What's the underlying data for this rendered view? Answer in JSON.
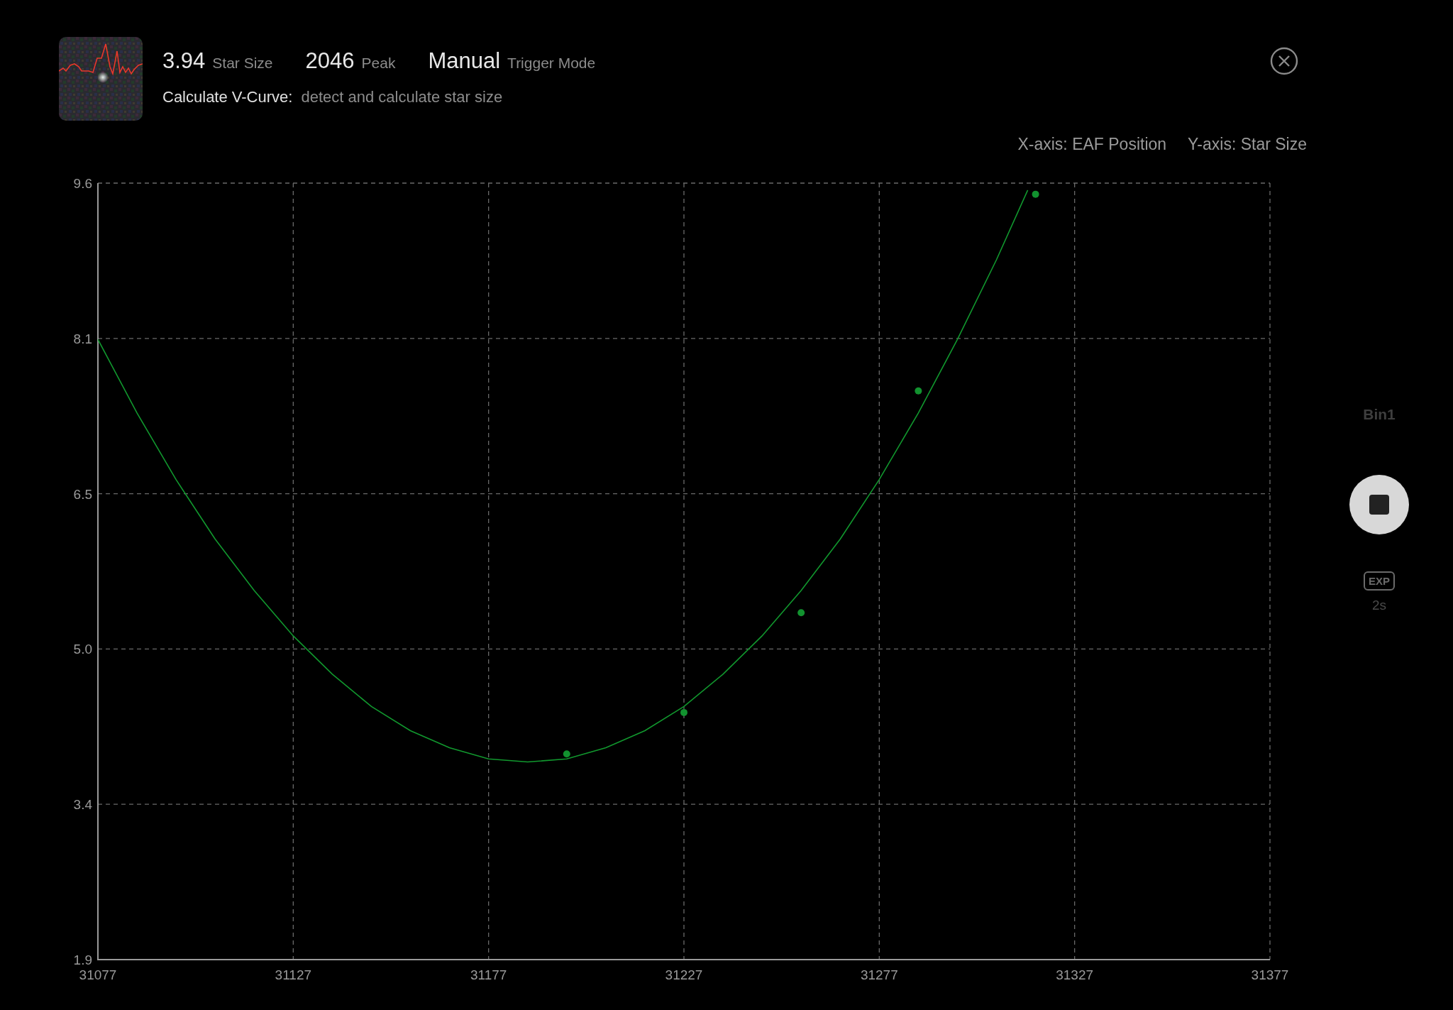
{
  "header": {
    "stats": [
      {
        "value": "3.94",
        "label": "Star Size"
      },
      {
        "value": "2046",
        "label": "Peak"
      },
      {
        "value": "Manual",
        "label": "Trigger Mode"
      }
    ],
    "task_title": "Calculate V-Curve:",
    "task_description": "detect and calculate star size"
  },
  "axis_legend": [
    "X-axis: EAF Position",
    "Y-axis: Star Size"
  ],
  "chart": {
    "chart_data": {
      "type": "scatter",
      "grid": true,
      "xlim": [
        31077,
        31377
      ],
      "ylim": [
        1.9,
        9.6
      ],
      "xticks": [
        31077,
        31127,
        31177,
        31227,
        31277,
        31327,
        31377
      ],
      "yticks": [
        {
          "value": 1.9,
          "label": "1.9"
        },
        {
          "value": 3.44,
          "label": "3.4"
        },
        {
          "value": 4.98,
          "label": "5.0"
        },
        {
          "value": 6.52,
          "label": "6.5"
        },
        {
          "value": 8.06,
          "label": "8.1"
        },
        {
          "value": 9.6,
          "label": "9.6"
        }
      ],
      "series": [
        {
          "type": "scatter",
          "color": "#12922f",
          "x": [
            31197,
            31227,
            31257,
            31287,
            31317
          ],
          "values": [
            3.94,
            4.35,
            5.34,
            7.54,
            9.49
          ]
        },
        {
          "type": "line",
          "color": "#11982e",
          "x": [
            31077,
            31087,
            31097,
            31107,
            31117,
            31127,
            31137,
            31147,
            31157,
            31167,
            31177,
            31187,
            31197,
            31207,
            31217,
            31227,
            31237,
            31247,
            31257,
            31267,
            31277,
            31287,
            31297,
            31307,
            31315
          ],
          "values": [
            8.05,
            7.32,
            6.66,
            6.07,
            5.56,
            5.11,
            4.73,
            4.41,
            4.17,
            4.0,
            3.89,
            3.86,
            3.89,
            4.0,
            4.17,
            4.41,
            4.73,
            5.11,
            5.56,
            6.07,
            6.66,
            7.32,
            8.05,
            8.84,
            9.53
          ]
        }
      ]
    }
  },
  "side_panel": {
    "binning": "Bin1",
    "exposure_badge": "EXP",
    "exposure_time": "2s"
  }
}
